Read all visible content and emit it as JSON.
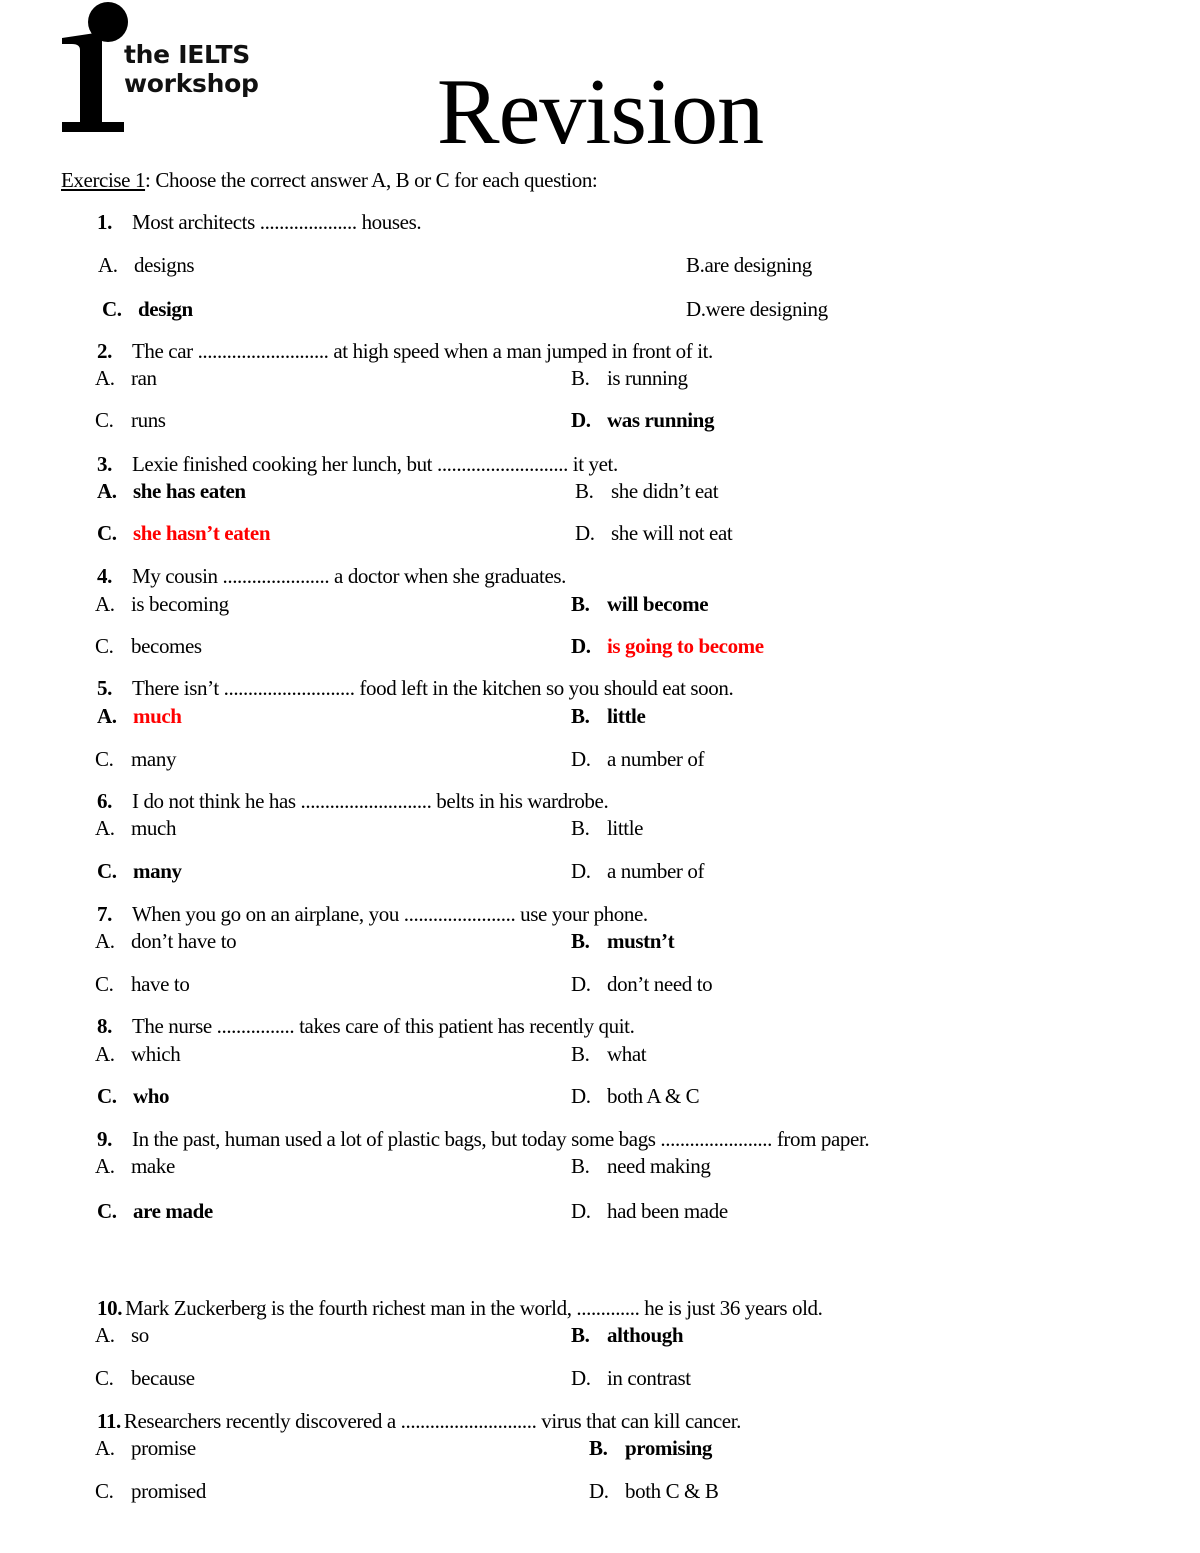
{
  "header": {
    "logo_mark": "i",
    "logo_line1": "the IELTS",
    "logo_line2": "workshop",
    "title": "Revision"
  },
  "exercise": {
    "label": "Exercise 1",
    "instruction": ": Choose the correct answer A, B or C for each question:"
  },
  "colors": {
    "highlight": "#ff0000",
    "text": "#000000"
  },
  "questions": [
    {
      "num": "1.",
      "text": "Most architects .................... houses.",
      "options": [
        {
          "label": "A.",
          "text": "designs",
          "style": "normal"
        },
        {
          "label": "B.",
          "text": "are designing",
          "style": "normal"
        },
        {
          "label": "C.",
          "text": "design",
          "style": "bold"
        },
        {
          "label": "D.",
          "text": "were designing",
          "style": "normal"
        }
      ]
    },
    {
      "num": "2.",
      "text": "The car ........................... at high speed when a man jumped in front of it.",
      "options": [
        {
          "label": "A.",
          "text": "ran",
          "style": "normal"
        },
        {
          "label": "B.",
          "text": "is running",
          "style": "normal"
        },
        {
          "label": "C.",
          "text": "runs",
          "style": "normal"
        },
        {
          "label": "D.",
          "text": "was running",
          "style": "bold"
        }
      ]
    },
    {
      "num": "3.",
      "text": "Lexie finished cooking her lunch, but ........................... it yet.",
      "options": [
        {
          "label": "A.",
          "text": "she has eaten",
          "style": "bold"
        },
        {
          "label": "B.",
          "text": "she didn’t eat",
          "style": "normal"
        },
        {
          "label": "C.",
          "text": "she hasn’t eaten",
          "style": "red"
        },
        {
          "label": "D.",
          "text": "she will not eat",
          "style": "normal"
        }
      ]
    },
    {
      "num": "4.",
      "text": "My cousin ...................... a doctor when she graduates.",
      "options": [
        {
          "label": "A.",
          "text": "is becoming",
          "style": "normal"
        },
        {
          "label": "B.",
          "text": "will become",
          "style": "bold"
        },
        {
          "label": "C.",
          "text": "becomes",
          "style": "normal"
        },
        {
          "label": "D.",
          "text": "is going to become",
          "style": "red"
        }
      ]
    },
    {
      "num": "5.",
      "text": "There isn’t ........................... food left in the kitchen so you should eat soon.",
      "options": [
        {
          "label": "A.",
          "text": "much",
          "style": "red"
        },
        {
          "label": "B.",
          "text": "little",
          "style": "bold"
        },
        {
          "label": "C.",
          "text": "many",
          "style": "normal"
        },
        {
          "label": "D.",
          "text": "a number of",
          "style": "normal"
        }
      ]
    },
    {
      "num": "6.",
      "text": "I do not think he has ........................... belts in his wardrobe.",
      "options": [
        {
          "label": "A.",
          "text": "much",
          "style": "normal"
        },
        {
          "label": "B.",
          "text": "little",
          "style": "normal"
        },
        {
          "label": "C.",
          "text": "many",
          "style": "bold"
        },
        {
          "label": "D.",
          "text": "a number of",
          "style": "normal"
        }
      ]
    },
    {
      "num": "7.",
      "text": "When you go on an airplane, you ....................... use your phone.",
      "options": [
        {
          "label": "A.",
          "text": "don’t have to",
          "style": "normal"
        },
        {
          "label": "B.",
          "text": "mustn’t",
          "style": "bold"
        },
        {
          "label": "C.",
          "text": "have to",
          "style": "normal"
        },
        {
          "label": "D.",
          "text": "don’t need to",
          "style": "normal"
        }
      ]
    },
    {
      "num": "8.",
      "text": "The nurse ................ takes care of this patient has recently quit.",
      "options": [
        {
          "label": "A.",
          "text": "which",
          "style": "normal"
        },
        {
          "label": "B.",
          "text": "what",
          "style": "normal"
        },
        {
          "label": "C.",
          "text": "who",
          "style": "bold"
        },
        {
          "label": "D.",
          "text": "both A & C",
          "style": "normal"
        }
      ]
    },
    {
      "num": "9.",
      "text": "In the past, human used a lot of plastic bags, but today some bags ....................... from paper.",
      "options": [
        {
          "label": "A.",
          "text": "make",
          "style": "normal"
        },
        {
          "label": "B.",
          "text": "need making",
          "style": "normal"
        },
        {
          "label": "C.",
          "text": "are made",
          "style": "bold"
        },
        {
          "label": "D.",
          "text": "had been made",
          "style": "normal"
        }
      ]
    },
    {
      "num": "10.",
      "text": "Mark Zuckerberg is the fourth richest man in the world, ............. he is just 36 years old.",
      "options": [
        {
          "label": "A.",
          "text": "so",
          "style": "normal"
        },
        {
          "label": "B.",
          "text": "although",
          "style": "bold"
        },
        {
          "label": "C.",
          "text": "because",
          "style": "normal"
        },
        {
          "label": "D.",
          "text": "in contrast",
          "style": "normal"
        }
      ]
    },
    {
      "num": "11.",
      "text": "Researchers recently discovered a ............................ virus that can kill cancer.",
      "options": [
        {
          "label": "A.",
          "text": "promise",
          "style": "normal"
        },
        {
          "label": "B.",
          "text": "promising",
          "style": "bold"
        },
        {
          "label": "C.",
          "text": "promised",
          "style": "normal"
        },
        {
          "label": "D.",
          "text": "both C & B",
          "style": "normal"
        }
      ]
    }
  ]
}
